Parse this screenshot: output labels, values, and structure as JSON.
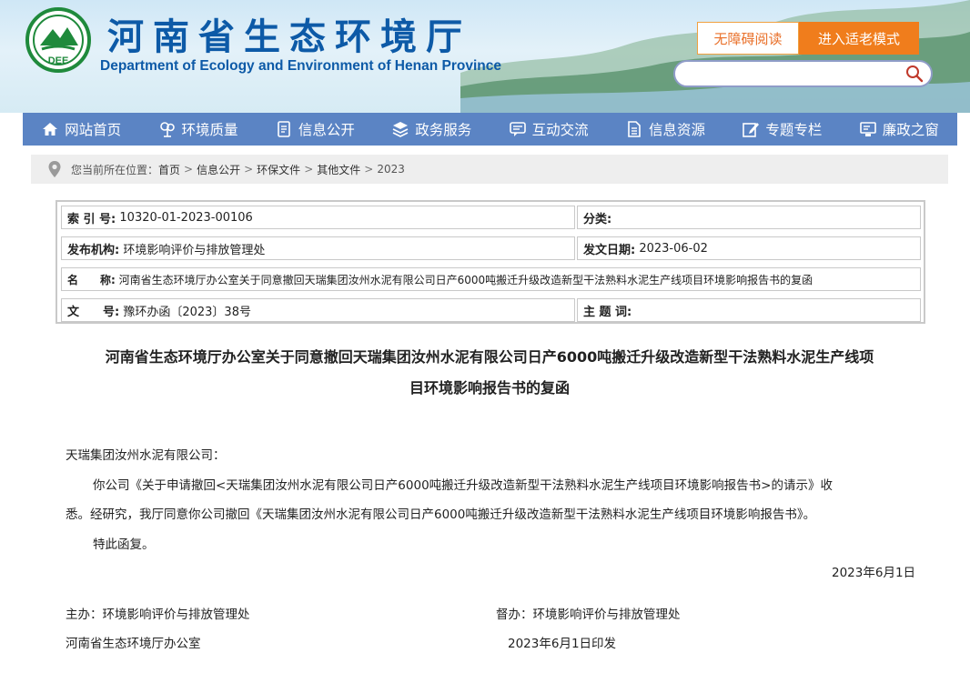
{
  "header": {
    "title": "河南省生态环境厅",
    "subtitle": "Department of Ecology and Environment of Henan Province",
    "logo_text": "DEE",
    "accessibility_label": "无障碍阅读",
    "elder_mode_label": "进入适老模式",
    "search_placeholder": ""
  },
  "nav": {
    "items": [
      {
        "label": "网站首页",
        "icon": "home-icon"
      },
      {
        "label": "环境质量",
        "icon": "tree-icon"
      },
      {
        "label": "信息公开",
        "icon": "document-icon"
      },
      {
        "label": "政务服务",
        "icon": "layers-icon"
      },
      {
        "label": "互动交流",
        "icon": "chat-icon"
      },
      {
        "label": "信息资源",
        "icon": "file-list-icon"
      },
      {
        "label": "专题专栏",
        "icon": "edit-icon"
      },
      {
        "label": "廉政之窗",
        "icon": "monitor-icon"
      }
    ]
  },
  "breadcrumb": {
    "prefix": "您当前所在位置：",
    "items": [
      "首页",
      "信息公开",
      "环保文件",
      "其他文件",
      "2023"
    ]
  },
  "meta": {
    "index_label": "索 引 号:",
    "index_value": "10320-01-2023-00106",
    "category_label": "分类:",
    "category_value": "",
    "publisher_label": "发布机构:",
    "publisher_value": "环境影响评价与排放管理处",
    "date_label": "发文日期:",
    "date_value": "2023-06-02",
    "name_label": "名　　称:",
    "name_value": "河南省生态环境厅办公室关于同意撤回天瑞集团汝州水泥有限公司日产6000吨搬迁升级改造新型干法熟料水泥生产线项目环境影响报告书的复函",
    "docno_label": "文　　号:",
    "docno_value": "豫环办函〔2023〕38号",
    "keywords_label": "主 题 词:",
    "keywords_value": ""
  },
  "article": {
    "title_line1": "河南省生态环境厅办公室关于同意撤回天瑞集团汝州水泥有限公司日产6000吨搬迁升级改造新型干法熟料水泥生产线项",
    "title_line2": "目环境影响报告书的复函",
    "addressee": "天瑞集团汝州水泥有限公司：",
    "line1": "你公司《关于申请撤回<天瑞集团汝州水泥有限公司日产6000吨搬迁升级改造新型干法熟料水泥生产线项目环境影响报告书>的请示》收",
    "line2": "悉。经研究，我厅同意你公司撤回《天瑞集团汝州水泥有限公司日产6000吨搬迁升级改造新型干法熟料水泥生产线项目环境影响报告书》。",
    "line3": "特此函复。",
    "date": "2023年6月1日",
    "host": "主办：环境影响评价与排放管理处",
    "supervisor": "督办：环境影响评价与排放管理处",
    "office": "河南省生态环境厅办公室",
    "issued": "2023年6月1日印发"
  },
  "colors": {
    "brand_blue": "#0d5aa7",
    "nav_bg": "#5b84c4",
    "elder_btn": "#f07d1c",
    "logo_green": "#1f8a3c"
  }
}
